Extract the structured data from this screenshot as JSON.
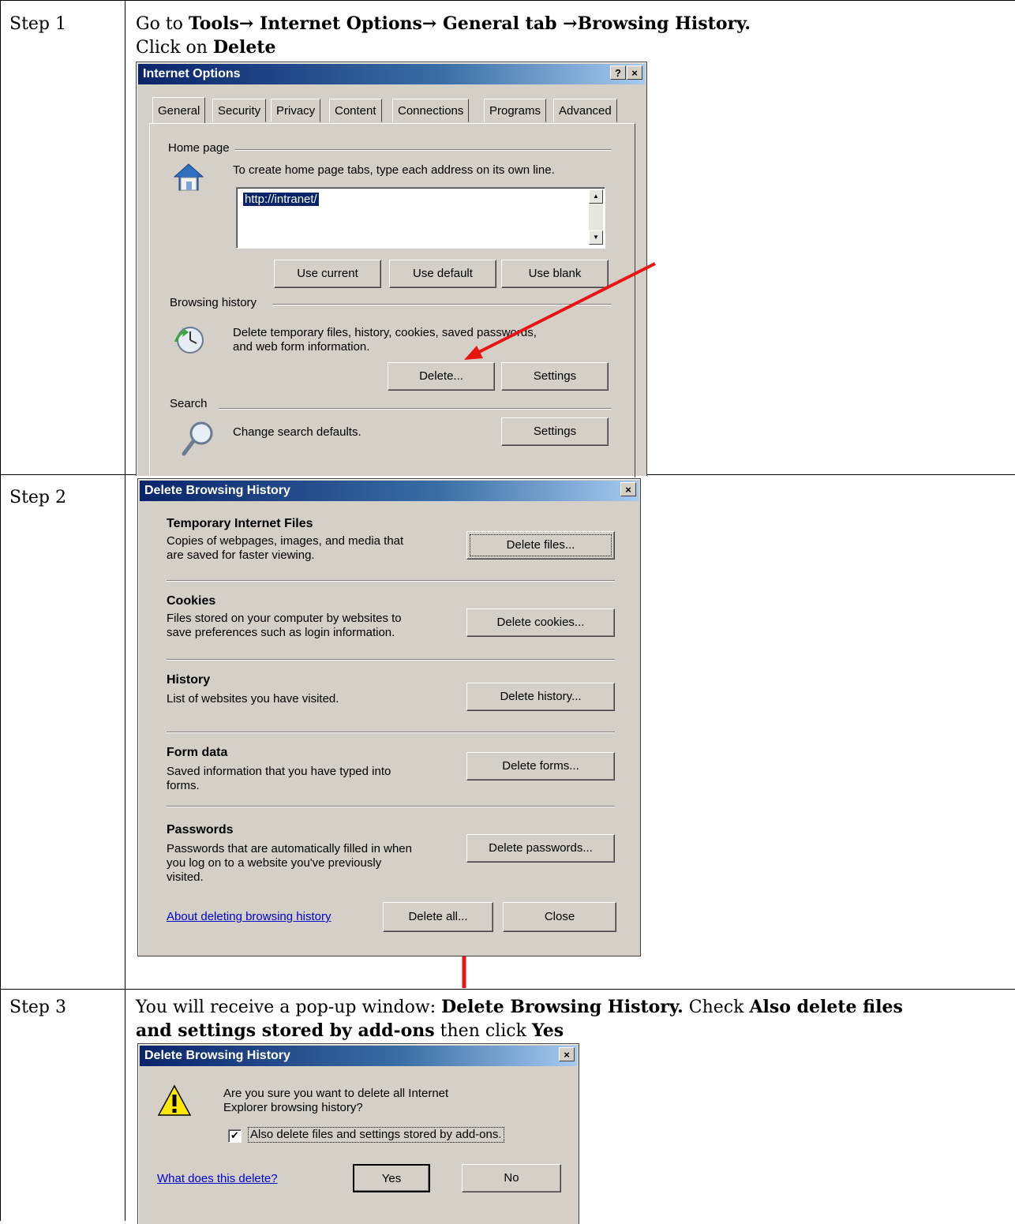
{
  "steps": [
    {
      "label": "Step 1",
      "line1": {
        "prefix": "Go to ",
        "tools": "Tools",
        "arrow1": "→ ",
        "internet_options": "Internet Options",
        "arrow2": "→ ",
        "general_tab": "General tab ",
        "arrow3": "→",
        "browsing_history": "Browsing History."
      },
      "line2": {
        "prefix": "Click on ",
        "delete": "Delete"
      }
    },
    {
      "label": "Step 2"
    },
    {
      "label": "Step 3",
      "line1": {
        "prefix": "You will receive a pop-up window:  ",
        "dbh": "Delete Browsing History.",
        "mid": "  Check ",
        "also": "Also delete files"
      },
      "line2": {
        "also2": "and settings stored by add-ons",
        "mid": " then click ",
        "yes": "Yes"
      }
    }
  ],
  "internet_options": {
    "title": "Internet Options",
    "help_btn": "?",
    "close_btn": "×",
    "tabs": [
      "General",
      "Security",
      "Privacy",
      "Content",
      "Connections",
      "Programs",
      "Advanced"
    ],
    "home_page": {
      "group": "Home page",
      "desc": "To create home page tabs, type each address on its own line.",
      "url": "http://intranet/",
      "buttons": [
        "Use current",
        "Use default",
        "Use blank"
      ]
    },
    "browsing_history": {
      "group": "Browsing history",
      "desc1": "Delete temporary files, history, cookies, saved passwords,",
      "desc2": "and web form information.",
      "delete": "Delete...",
      "settings": "Settings"
    },
    "search": {
      "group": "Search",
      "desc": "Change search defaults.",
      "settings": "Settings"
    }
  },
  "delete_history": {
    "title": "Delete Browsing History",
    "close_btn": "×",
    "sections": [
      {
        "heading": "Temporary Internet Files",
        "desc1": "Copies of webpages, images, and media that",
        "desc2": "are saved for faster viewing.",
        "desc3": "",
        "button": "Delete files..."
      },
      {
        "heading": "Cookies",
        "desc1": "Files stored on your computer by websites to",
        "desc2": "save preferences such as login information.",
        "desc3": "",
        "button": "Delete cookies..."
      },
      {
        "heading": "History",
        "desc1": "List of websites you have visited.",
        "desc2": "",
        "desc3": "",
        "button": "Delete history..."
      },
      {
        "heading": "Form data",
        "desc1": "Saved information that you have typed into",
        "desc2": "forms.",
        "desc3": "",
        "button": "Delete forms..."
      },
      {
        "heading": "Passwords",
        "desc1": "Passwords that are automatically filled in when",
        "desc2": "you log on to a website you've previously",
        "desc3": "visited.",
        "button": "Delete passwords..."
      }
    ],
    "about_link": "About deleting browsing history",
    "delete_all": "Delete all...",
    "close": "Close"
  },
  "confirm": {
    "title": "Delete Browsing History",
    "close_btn": "×",
    "message1": "Are you sure you want to delete all Internet",
    "message2": "Explorer browsing history?",
    "checkbox_label": "Also delete files and settings stored by add-ons.",
    "checkbox_checked": true,
    "link": "What does this delete?",
    "yes": "Yes",
    "no": "No"
  },
  "colors": {
    "arrow": "#e8140f",
    "titlebar": "#0a246a",
    "dialog_bg": "#d4d0c8",
    "selection": "#0a246a"
  }
}
